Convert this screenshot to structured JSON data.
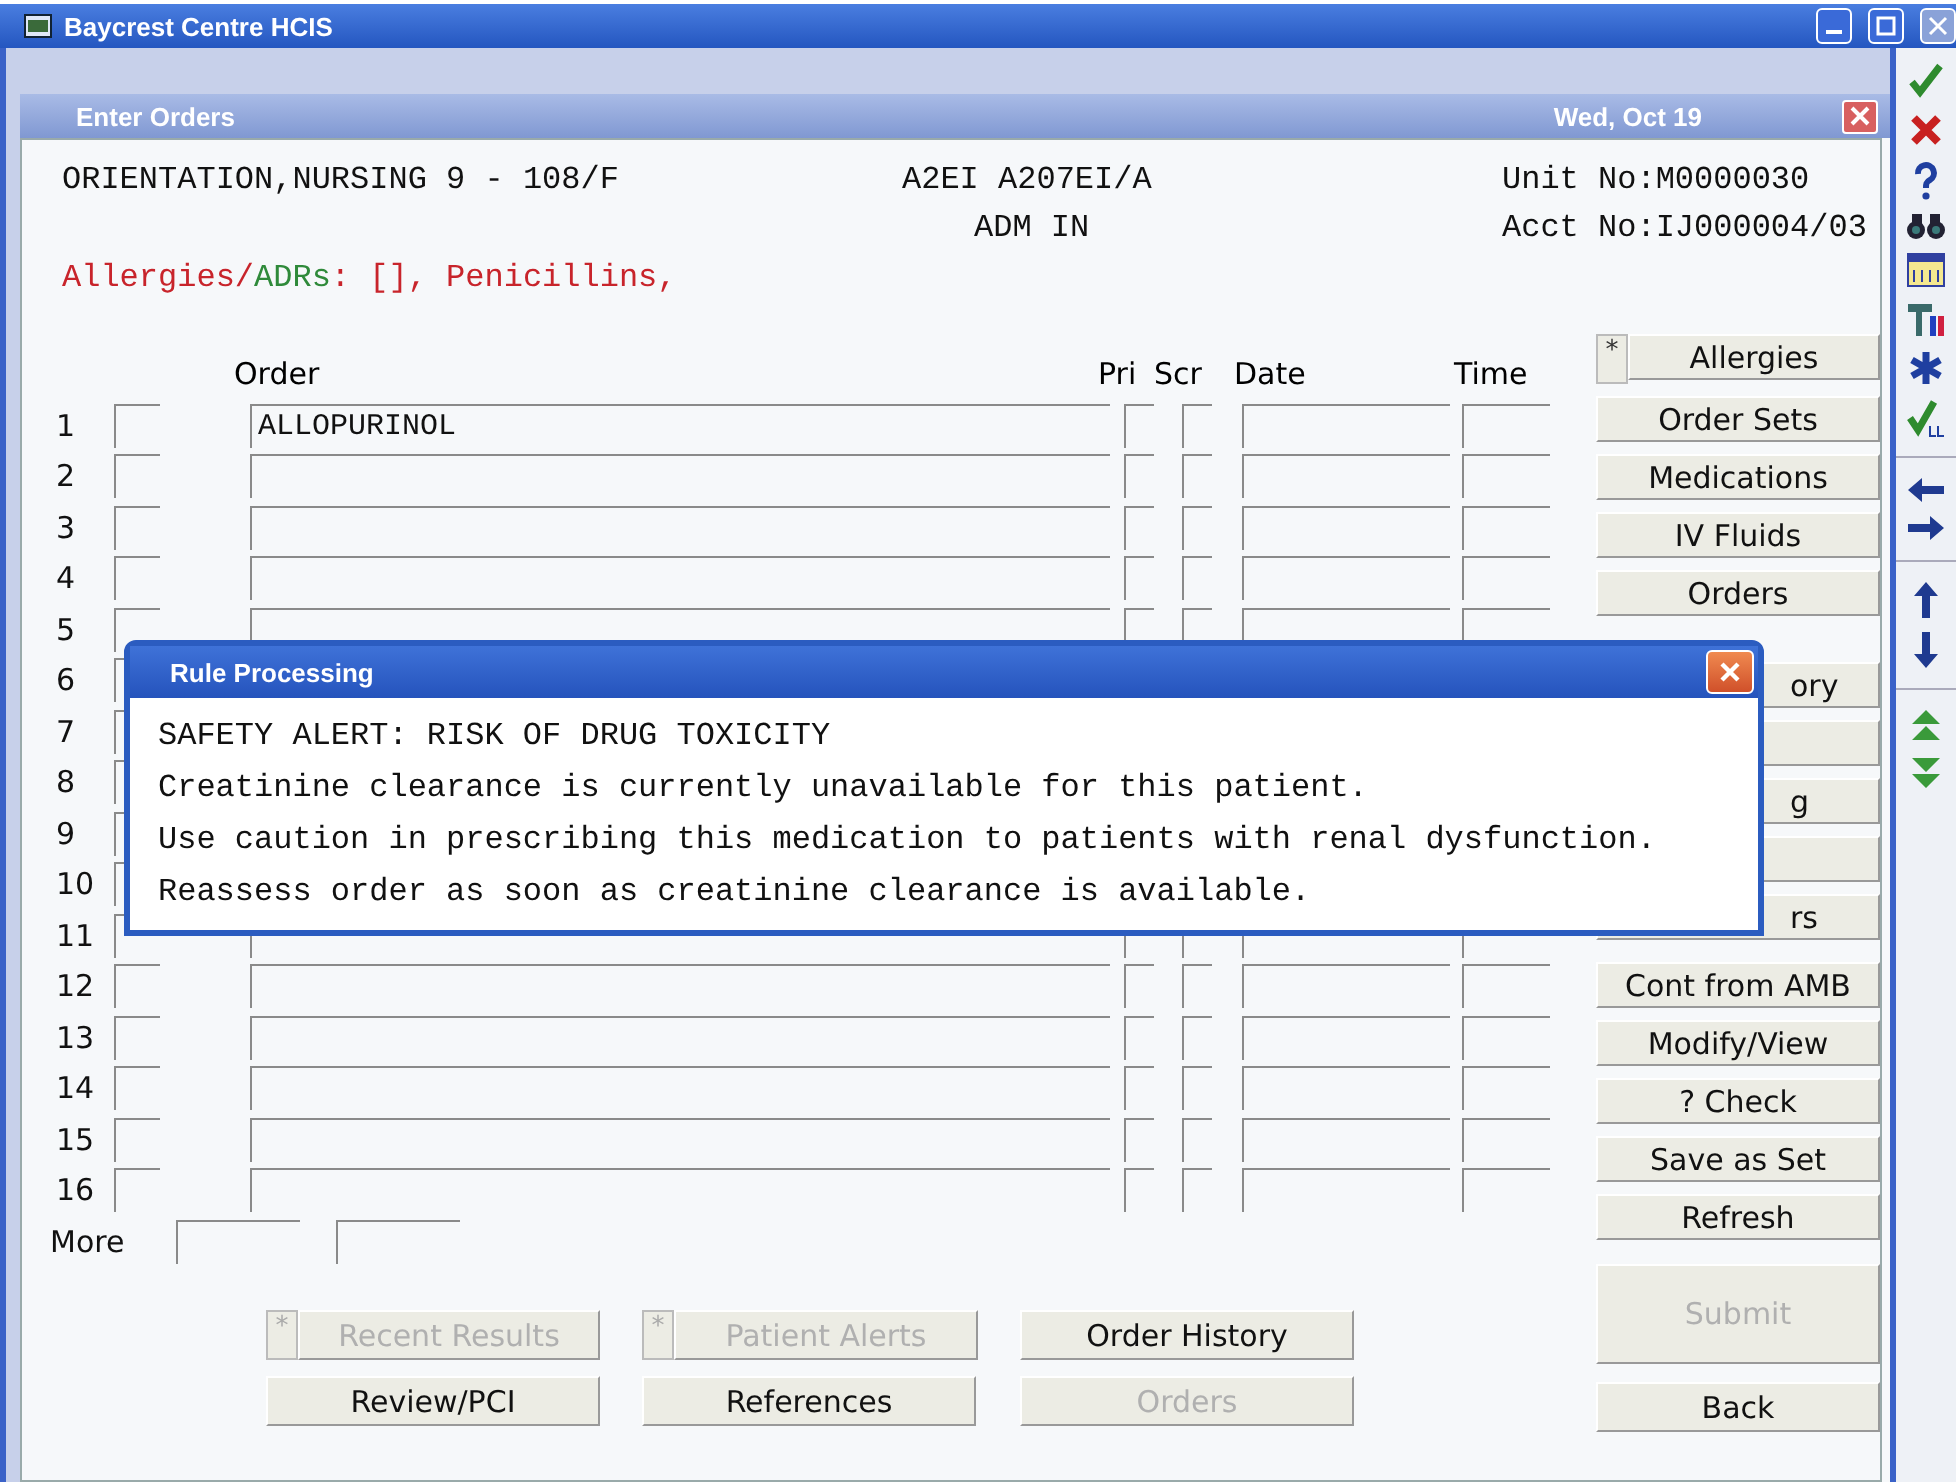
{
  "window": {
    "title": "Baycrest Centre HCIS"
  },
  "subwindow": {
    "title": "Enter Orders",
    "date": "Wed, Oct 19"
  },
  "patient": {
    "name": "ORIENTATION,NURSING 9 - 108/F",
    "location": "A2EI A207EI/A",
    "status": "ADM IN",
    "unit_no": "Unit No:M0000030",
    "acct_no": "Acct No:IJ000004/03"
  },
  "allergy_line": [
    {
      "text": "Allergies/",
      "color": "#c8242b"
    },
    {
      "text": "ADRs",
      "color": "#2f8a3a"
    },
    {
      "text": ": [], Penicillins,",
      "color": "#c8242b"
    }
  ],
  "columns": [
    "Order",
    "Pri",
    "Scr",
    "Date",
    "Time"
  ],
  "rows": [
    {
      "number": "1",
      "order": "ALLOPURINOL"
    },
    {
      "number": "2"
    },
    {
      "number": "3"
    },
    {
      "number": "4"
    },
    {
      "number": "5"
    },
    {
      "number": "6",
      "covered": true
    },
    {
      "number": "7",
      "covered": true
    },
    {
      "number": "8",
      "covered": true
    },
    {
      "number": "9",
      "covered": true
    },
    {
      "number": "10",
      "covered": true
    },
    {
      "number": "11"
    },
    {
      "number": "12"
    },
    {
      "number": "13"
    },
    {
      "number": "14"
    },
    {
      "number": "15"
    },
    {
      "number": "16"
    }
  ],
  "more_label": "More",
  "side_groups": [
    [
      {
        "kind": "star",
        "star": "*",
        "label": "Allergies"
      },
      {
        "kind": "plain",
        "label": "Order Sets"
      },
      {
        "kind": "plain",
        "label": "Medications"
      },
      {
        "kind": "plain",
        "label": "IV Fluids"
      },
      {
        "kind": "plain",
        "label": "Orders"
      }
    ],
    [
      {
        "kind": "covered",
        "label": "ory"
      },
      {
        "kind": "covered"
      },
      {
        "kind": "covered",
        "label": "g"
      },
      {
        "kind": "covered"
      },
      {
        "kind": "covered",
        "label": "rs"
      }
    ],
    [
      {
        "kind": "plain",
        "label": "Cont from AMB"
      },
      {
        "kind": "plain",
        "label": "Modify/View"
      },
      {
        "kind": "plain",
        "label": "? Check"
      },
      {
        "kind": "plain",
        "label": "Save as Set"
      },
      {
        "kind": "plain",
        "label": "Refresh"
      }
    ]
  ],
  "submit": {
    "label": "Submit",
    "disabled": true
  },
  "back": {
    "label": "Back",
    "disabled": false
  },
  "bottom_buttons": [
    {
      "kind": "star",
      "star": "*",
      "label": "Recent Results",
      "disabled": true
    },
    {
      "kind": "star",
      "star": "*",
      "label": "Patient Alerts",
      "disabled": true
    },
    {
      "kind": "plain",
      "label": "Order History",
      "disabled": false
    },
    {
      "kind": "plain",
      "label": "Review/PCI",
      "disabled": false
    },
    {
      "kind": "plain",
      "label": "References",
      "disabled": false
    },
    {
      "kind": "plain",
      "label": "Orders",
      "disabled": true
    }
  ],
  "dialog": {
    "title": "Rule Processing",
    "lines": [
      "SAFETY ALERT: RISK OF DRUG TOXICITY",
      "Creatinine clearance is currently unavailable for this patient.",
      "Use caution in prescribing this medication to patients with renal dysfunction.",
      "Reassess order as soon as creatinine clearance is available."
    ]
  }
}
